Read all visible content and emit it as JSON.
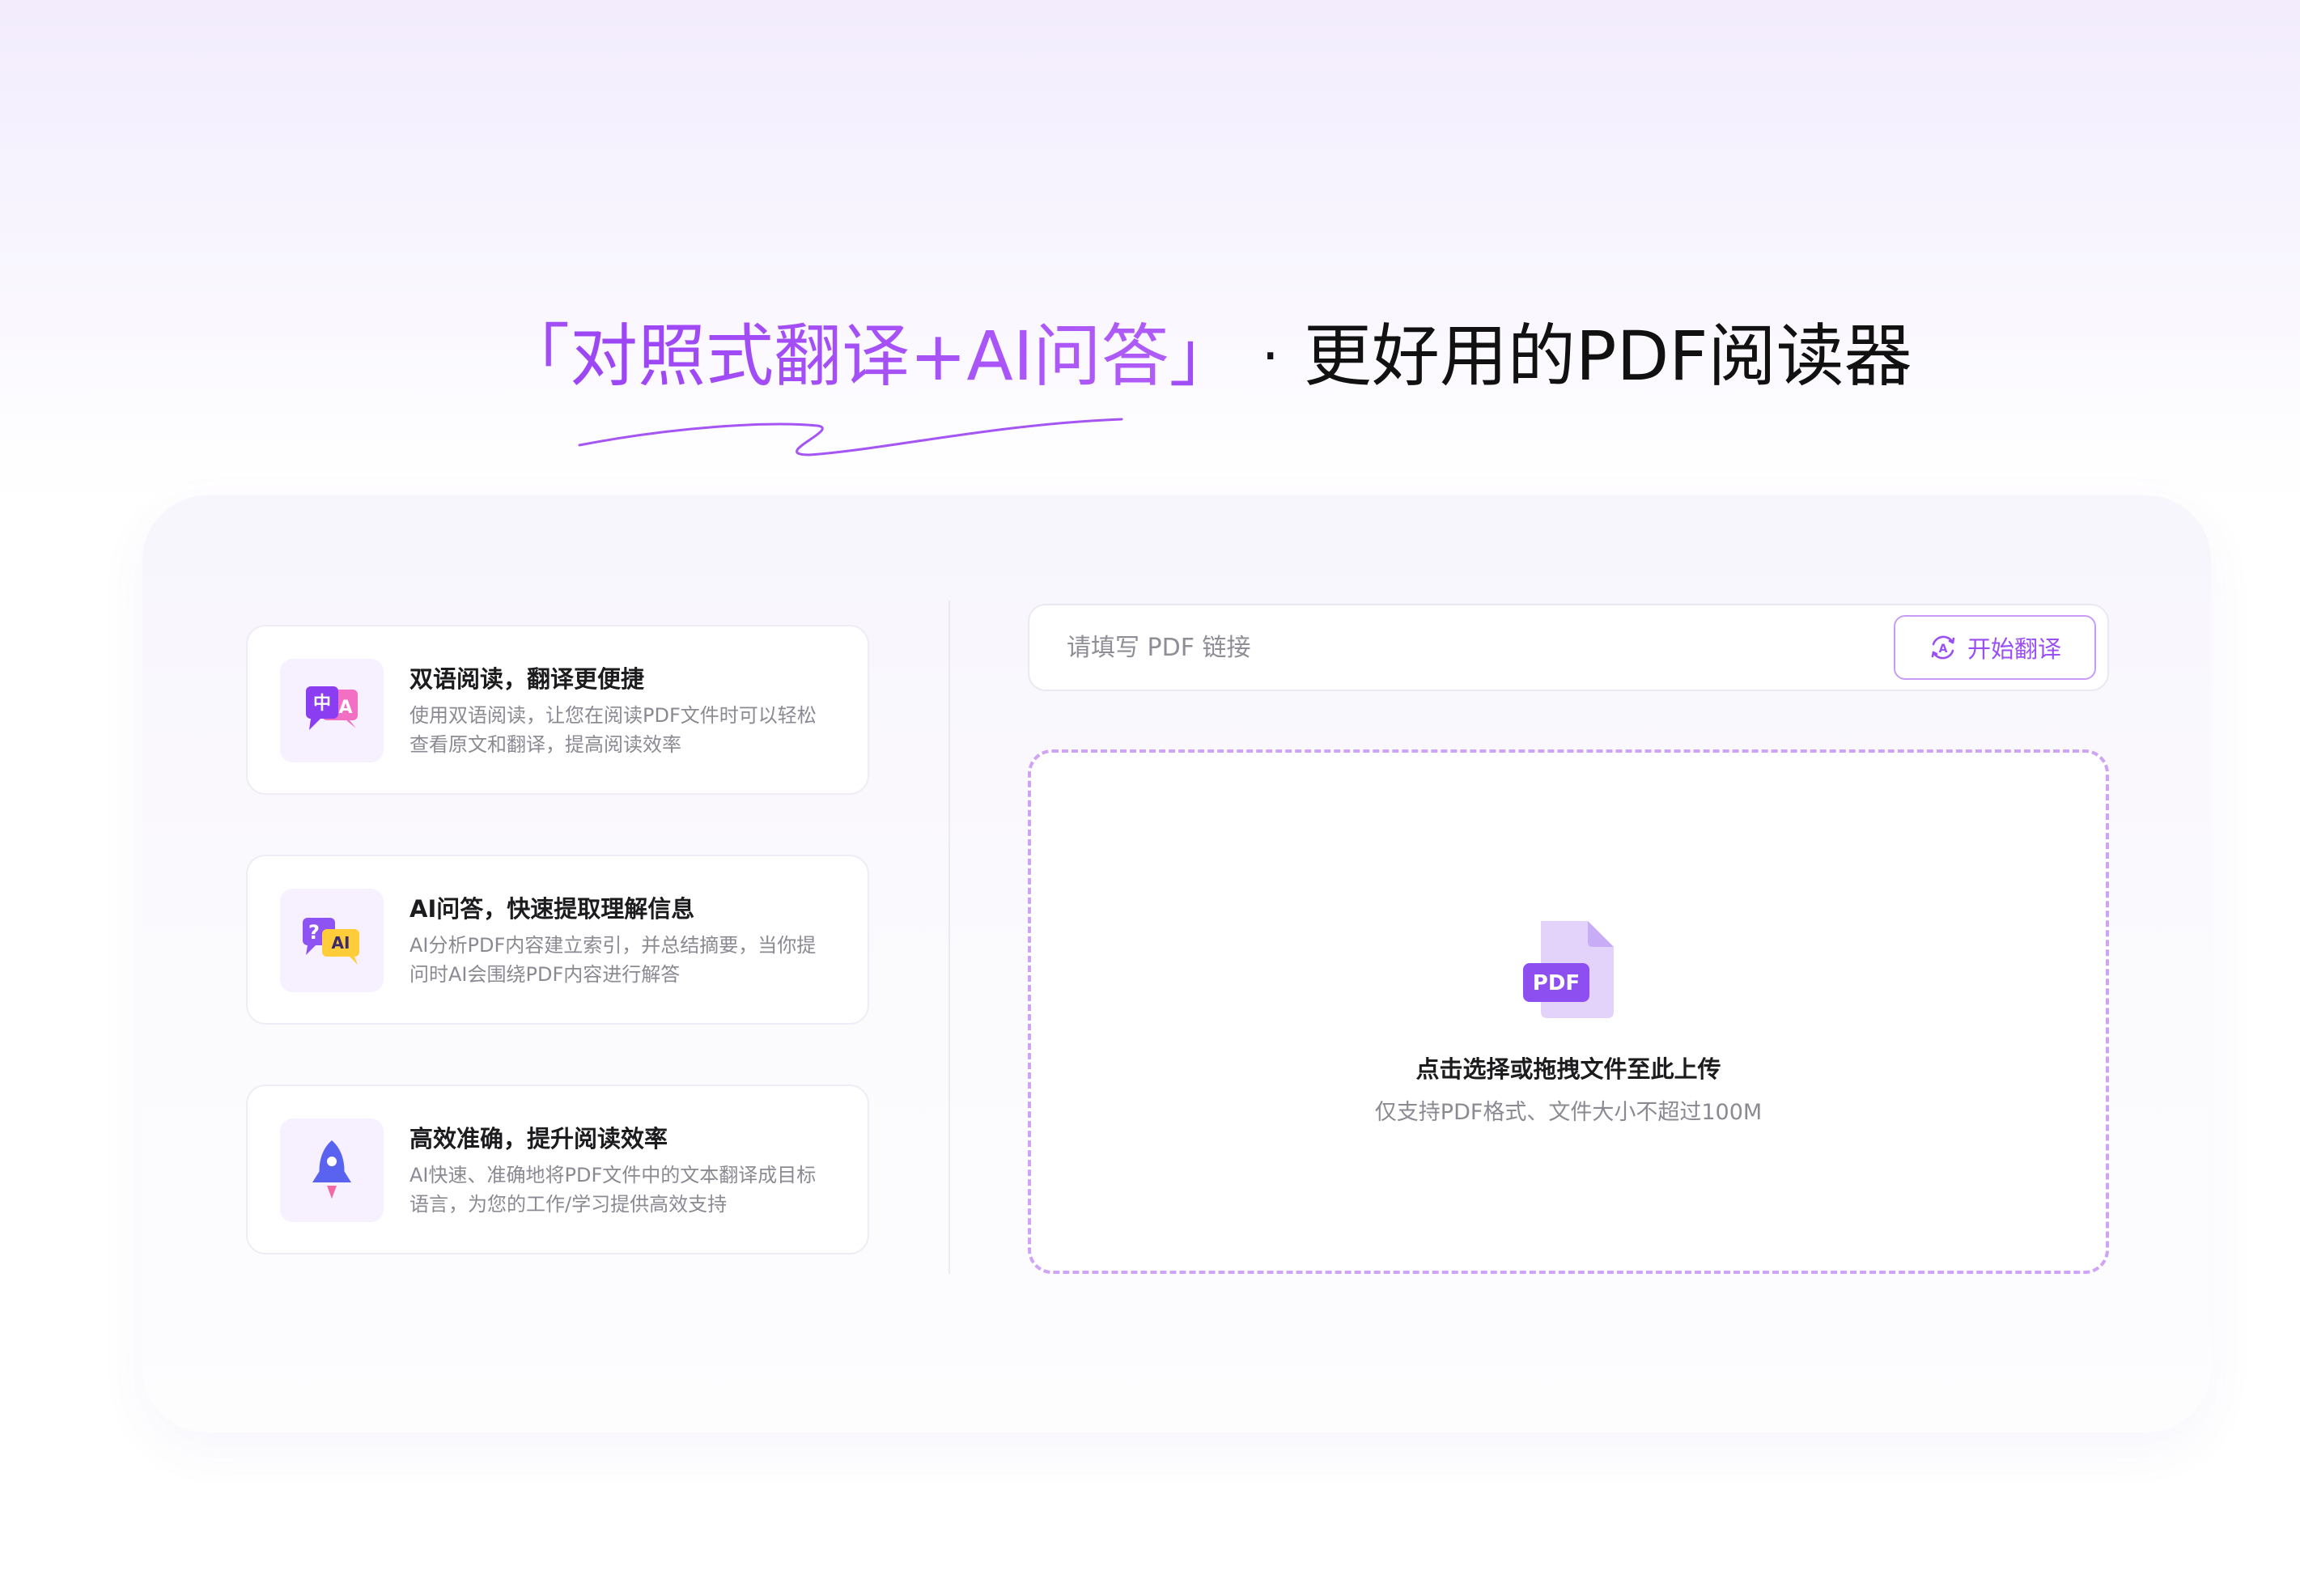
{
  "hero": {
    "bracket_left": "「",
    "accent": "对照式翻译+AI问答",
    "bracket_right": "」",
    "separator": "·",
    "rest": "更好用的PDF阅读器"
  },
  "features": [
    {
      "icon": "bilingual-translate-icon",
      "title": "双语阅读，翻译更便捷",
      "desc": "使用双语阅读，让您在阅读PDF文件时可以轻松查看原文和翻译，提高阅读效率"
    },
    {
      "icon": "ai-qa-icon",
      "title": "AI问答，快速提取理解信息",
      "desc": "AI分析PDF内容建立索引，并总结摘要，当你提问时AI会围绕PDF内容进行解答"
    },
    {
      "icon": "rocket-icon",
      "title": "高效准确，提升阅读效率",
      "desc": "AI快速、准确地将PDF文件中的文本翻译成目标语言，为您的工作/学习提供高效支持"
    }
  ],
  "link_bar": {
    "placeholder": "请填写 PDF 链接",
    "value": "",
    "button_label": "开始翻译",
    "button_icon": "translate-icon"
  },
  "dropzone": {
    "icon": "pdf-file-icon",
    "icon_text": "PDF",
    "title": "点击选择或拖拽文件至此上传",
    "subtitle": "仅支持PDF格式、文件大小不超过100M"
  },
  "colors": {
    "accent": "#a24ef6",
    "dash_border": "#cfa4f7",
    "button_border": "#c89cf6"
  }
}
